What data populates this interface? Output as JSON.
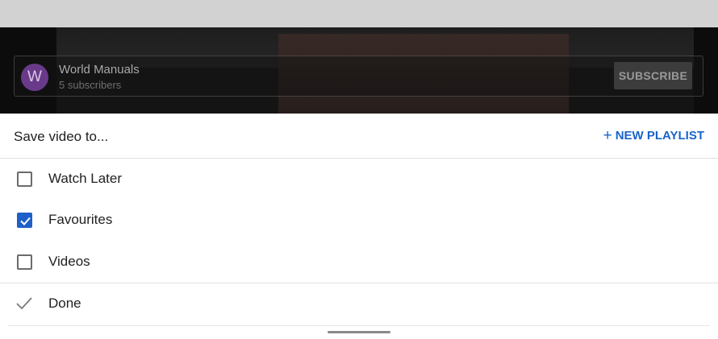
{
  "video": {
    "channel_avatar_letter": "W",
    "channel_name": "World Manuals",
    "subscriber_count": "5 subscribers",
    "subscribe_label": "SUBSCRIBE",
    "more_icon": "more-vert-icon",
    "close_icon": "close-icon"
  },
  "sheet": {
    "title": "Save video to...",
    "new_playlist_label": "NEW PLAYLIST",
    "playlists": [
      {
        "label": "Watch Later",
        "checked": false
      },
      {
        "label": "Favourites",
        "checked": true
      },
      {
        "label": "Videos",
        "checked": false
      }
    ],
    "done_label": "Done"
  },
  "colors": {
    "accent": "#1f5fc8",
    "link": "#1a63c9"
  }
}
